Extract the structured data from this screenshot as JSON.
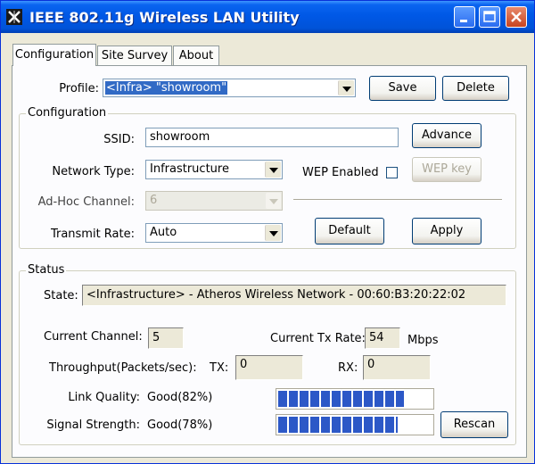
{
  "window": {
    "title": "IEEE 802.11g Wireless LAN Utility"
  },
  "tabs": [
    {
      "label": "Configuration",
      "active": true
    },
    {
      "label": "Site Survey",
      "active": false
    },
    {
      "label": "About",
      "active": false
    }
  ],
  "profile": {
    "label": "Profile:",
    "value": "<Infra> \"showroom\"",
    "save": "Save",
    "delete": "Delete"
  },
  "configuration": {
    "group_title": "Configuration",
    "ssid_label": "SSID:",
    "ssid_value": "showroom",
    "advance": "Advance",
    "network_type_label": "Network Type:",
    "network_type_value": "Infrastructure",
    "wep_enabled_label": "WEP Enabled",
    "wep_enabled_checked": false,
    "wep_key": "WEP key",
    "adhoc_channel_label": "Ad-Hoc Channel:",
    "adhoc_channel_value": "6",
    "transmit_rate_label": "Transmit Rate:",
    "transmit_rate_value": "Auto",
    "default": "Default",
    "apply": "Apply"
  },
  "status": {
    "group_title": "Status",
    "state_label": "State:",
    "state_value": "<Infrastructure> - Atheros Wireless Network - 00:60:B3:20:22:02",
    "current_channel_label": "Current Channel:",
    "current_channel_value": "5",
    "current_tx_rate_label": "Current Tx Rate:",
    "current_tx_rate_value": "54",
    "tx_rate_unit": "Mbps",
    "throughput_label": "Throughput(Packets/sec):",
    "tx_label": "TX:",
    "tx_value": "0",
    "rx_label": "RX:",
    "rx_value": "0",
    "link_quality_label": "Link Quality:",
    "link_quality_value": "Good(82%)",
    "link_quality_percent": 82,
    "signal_strength_label": "Signal Strength:",
    "signal_strength_value": "Good(78%)",
    "signal_strength_percent": 78,
    "rescan": "Rescan"
  },
  "colors": {
    "titlebar": "#0058e6",
    "progress": "#2c58c7",
    "dialog": "#ece9d8"
  }
}
